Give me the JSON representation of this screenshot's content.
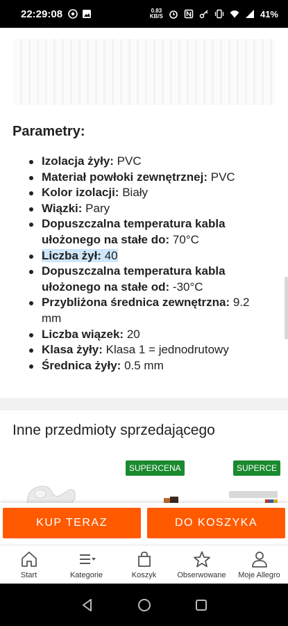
{
  "status_bar": {
    "time": "22:29:08",
    "net_speed_value": "0.83",
    "net_speed_unit": "KB/S",
    "battery": "41%"
  },
  "params": {
    "title": "Parametry:",
    "items": [
      {
        "label": "Izolacja żyły:",
        "value": "PVC"
      },
      {
        "label": "Materiał powłoki zewnętrznej:",
        "value": "PVC"
      },
      {
        "label": "Kolor izolacji:",
        "value": "Biały"
      },
      {
        "label": "Wiązki:",
        "value": "Pary"
      },
      {
        "label": "Dopuszczalna temperatura kabla ułożonego na stałe do:",
        "value": "70°C"
      },
      {
        "label": "Liczba żył:",
        "value": "40"
      },
      {
        "label": "Dopuszczalna temperatura kabla ułożonego na stałe od:",
        "value": "-30°C"
      },
      {
        "label": "Przybliżona średnica zewnętrzna:",
        "value": "9.2 mm"
      },
      {
        "label": "Liczba wiązek:",
        "value": "20"
      },
      {
        "label": "Klasa żyły:",
        "value": "Klasa 1 = jednodrutowy"
      },
      {
        "label": "Średnica żyły:",
        "value": "0.5 mm"
      }
    ]
  },
  "other_items": {
    "title": "Inne przedmioty sprzedającego",
    "badges": [
      "SUPERCENA",
      "SUPERCE"
    ]
  },
  "actions": {
    "buy_now": "KUP TERAZ",
    "add_to_cart": "DO KOSZYKA"
  },
  "bottom_nav": {
    "items": [
      {
        "label": "Start",
        "icon": "home-icon"
      },
      {
        "label": "Kategorie",
        "icon": "categories-icon"
      },
      {
        "label": "Koszyk",
        "icon": "cart-icon"
      },
      {
        "label": "Obserwowane",
        "icon": "star-icon"
      },
      {
        "label": "Moje Allegro",
        "icon": "user-icon"
      }
    ]
  },
  "colors": {
    "accent": "#ff5a00",
    "badge": "#1a8a2f",
    "highlight": "#cfe7fb"
  }
}
